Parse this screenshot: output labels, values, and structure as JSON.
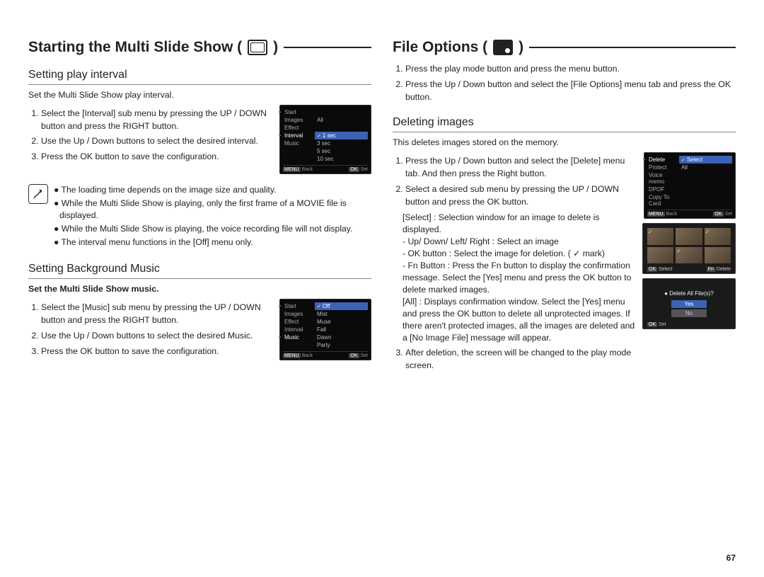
{
  "page_number": "67",
  "left": {
    "title": "Starting the Multi Slide Show (",
    "title_end": ")",
    "sec1": {
      "heading": "Setting play interval",
      "intro": "Set the Multi Slide Show play interval.",
      "steps": [
        "Select the [Interval] sub menu by pressing the UP / DOWN button and press the RIGHT button.",
        "Use the Up / Down buttons to select the desired interval.",
        "Press the OK button to save the configuration."
      ],
      "notes": [
        "The loading time depends on the image size and quality.",
        "While the Multi Slide Show is playing, only the first frame of a MOVIE file is displayed.",
        "While the Multi Slide Show is playing, the voice recording file will not display.",
        "The interval menu functions in the [Off] menu only."
      ],
      "lcd": {
        "menu": [
          "Start",
          "Images",
          "Effect",
          "Interval",
          "Music"
        ],
        "active": "Interval",
        "side_right": [
          "All"
        ],
        "opts": [
          "1 sec",
          "3 sec",
          "5 sec",
          "10 sec"
        ],
        "selected": "1 sec",
        "back": "Back",
        "set": "Set",
        "back_key": "MENU",
        "set_key": "OK"
      }
    },
    "sec2": {
      "heading": "Setting Background Music",
      "intro": "Set the Multi Slide Show music.",
      "steps": [
        "Select the [Music] sub menu by pressing the UP / DOWN button and press the RIGHT button.",
        "Use the Up / Down buttons to select the desired Music.",
        "Press the OK button to save the configuration."
      ],
      "lcd": {
        "menu": [
          "Start",
          "Images",
          "Effect",
          "Interval",
          "Music"
        ],
        "active": "Music",
        "opts": [
          "Off",
          "Mist",
          "Muse",
          "Fall",
          "Dawn",
          "Party"
        ],
        "selected": "Off",
        "back": "Back",
        "set": "Set",
        "back_key": "MENU",
        "set_key": "OK"
      }
    }
  },
  "right": {
    "title": "File Options (",
    "title_end": ")",
    "intro_steps": [
      "Press the play mode button and press the menu button.",
      "Press the Up / Down button and select the [File Options] menu tab and press the OK button."
    ],
    "sec1": {
      "heading": "Deleting images",
      "intro": "This deletes images stored on the memory.",
      "steps": [
        "Press the Up / Down button and select the [Delete] menu tab. And then press the Right button.",
        "Select a desired sub menu by pressing the UP / DOWN button and press the OK button."
      ],
      "sub_select_label": "[Select] : Selection window for an image to delete is displayed.",
      "sub_select_lines": [
        "- Up/ Down/ Left/ Right : Select an image",
        "- OK button : Select the image for deletion. ( ✓ mark)",
        "- Fn Button : Press the Fn button to display the confirmation message. Select the [Yes] menu and press the OK button to delete marked images."
      ],
      "sub_all_label": "[All] : Displays confirmation window. Select the [Yes] menu and press the OK button to delete all unprotected images. If there aren't protected images, all the images are deleted and a [No Image File] message will appear.",
      "step3": "After deletion, the screen will be changed to the play mode screen.",
      "lcd_delete": {
        "menu": [
          "Delete",
          "Protect",
          "Voice memo",
          "DPOF",
          "Copy To Card"
        ],
        "active": "Delete",
        "opts": [
          "Select",
          "All"
        ],
        "selected": "Select",
        "back": "Back",
        "set": "Set",
        "back_key": "MENU",
        "set_key": "OK"
      },
      "lcd_grid": {
        "select_label": "Select",
        "delete_label": "Delete",
        "select_key": "OK",
        "delete_key": "Fn"
      },
      "lcd_confirm": {
        "question": "Delete All File(s)?",
        "yes": "Yes",
        "no": "No",
        "set": "Set",
        "set_key": "OK"
      }
    }
  }
}
